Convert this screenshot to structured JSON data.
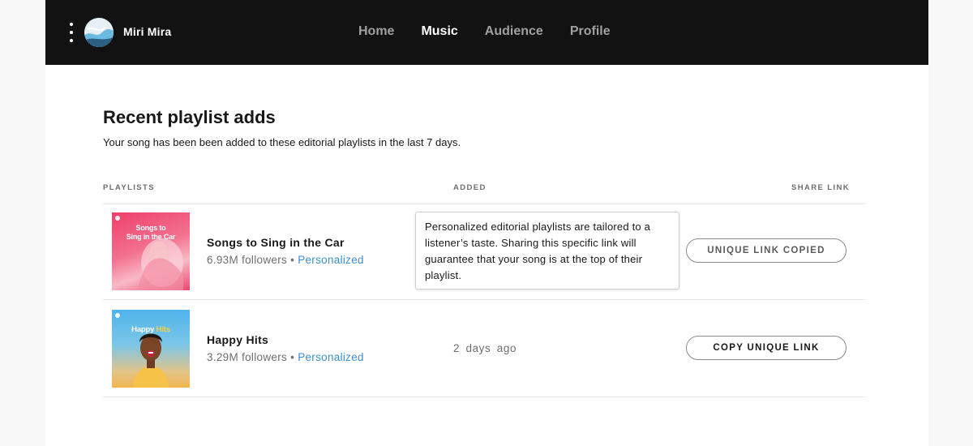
{
  "header": {
    "artist_name": "Miri Mira",
    "nav": [
      {
        "label": "Home",
        "active": false
      },
      {
        "label": "Music",
        "active": true
      },
      {
        "label": "Audience",
        "active": false
      },
      {
        "label": "Profile",
        "active": false
      }
    ]
  },
  "section": {
    "title": "Recent playlist adds",
    "subtitle": "Your song has been been added to these editorial playlists in the last 7 days."
  },
  "table": {
    "columns": [
      "PLAYLISTS",
      "ADDED",
      "SHARE LINK"
    ],
    "rows": [
      {
        "art_text": [
          "Songs to",
          "Sing in the Car"
        ],
        "name": "Songs to Sing in the Car",
        "followers": "6.93M followers",
        "separator": " • ",
        "tag": "Personalized",
        "added": "",
        "button": "UNIQUE LINK COPIED"
      },
      {
        "art_text_a": "Happy",
        "art_text_b": "Hits",
        "name": "Happy Hits",
        "followers": "3.29M followers",
        "separator": " • ",
        "tag": "Personalized",
        "added": "2 days ago",
        "button": "COPY UNIQUE LINK"
      }
    ]
  },
  "tooltip": {
    "text": "Personalized editorial playlists are tailored to a listener’s taste. Sharing this specific link will guarantee that your song is at the top of their playlist."
  },
  "colors": {
    "topbar": "#121212",
    "accent_link": "#3a8fd6",
    "art1_gradient": [
      "#f0436f",
      "#f7a1b5"
    ],
    "art2_gradient": [
      "#4fb0e8",
      "#f6b74c"
    ]
  },
  "icons": {
    "menu": "kebab-menu-icon",
    "spotify_mark": "spotify-logo-icon"
  }
}
